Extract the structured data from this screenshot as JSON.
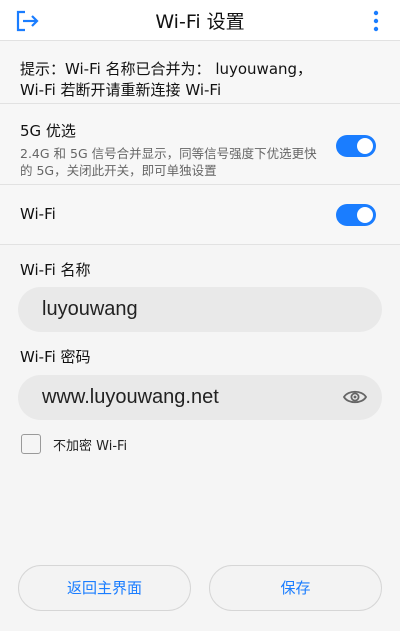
{
  "header": {
    "title": "Wi-Fi 设置",
    "exit_icon": "exit-icon",
    "more_icon": "more-vertical-icon"
  },
  "notice": {
    "line1": "提示：Wi-Fi 名称已合并为： luyouwang，",
    "line2": "Wi-Fi 若断开请重新连接 Wi-Fi"
  },
  "settings": {
    "five_g": {
      "label": "5G 优选",
      "description": "2.4G 和 5G 信号合并显示，同等信号强度下优选更快的 5G，关闭此开关，即可单独设置",
      "enabled": true
    },
    "wifi": {
      "label": "Wi-Fi",
      "enabled": true
    }
  },
  "form": {
    "name_label": "Wi-Fi 名称",
    "name_value": "luyouwang",
    "password_label": "Wi-Fi 密码",
    "password_value": "www.luyouwang.net",
    "eye_icon": "eye-icon",
    "no_encrypt_label": "不加密 Wi-Fi",
    "no_encrypt_checked": false
  },
  "buttons": {
    "back": "返回主界面",
    "save": "保存"
  },
  "colors": {
    "accent": "#1a7dff"
  }
}
